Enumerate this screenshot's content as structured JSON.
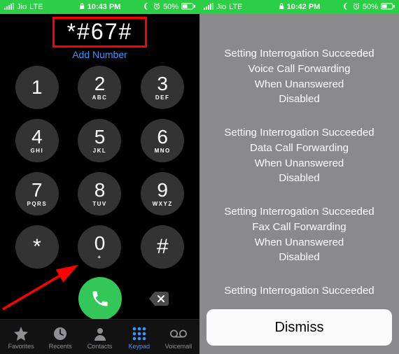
{
  "status_left": {
    "bars_icon": "signal-bars",
    "carrier": "Jio",
    "network": "LTE",
    "time": "10:43 PM",
    "moon_icon": "dnd-moon",
    "alarm_icon": "alarm",
    "battery_text": "50%",
    "battery_icon": "battery-half"
  },
  "status_right": {
    "bars_icon": "signal-bars",
    "carrier": "Jio",
    "network": "LTE",
    "time": "10:42 PM",
    "moon_icon": "dnd-moon",
    "alarm_icon": "alarm",
    "battery_text": "50%",
    "battery_icon": "battery-half"
  },
  "dialer": {
    "number": "*#67#",
    "add_number": "Add Number",
    "keys": [
      {
        "d": "1",
        "l": ""
      },
      {
        "d": "2",
        "l": "ABC"
      },
      {
        "d": "3",
        "l": "DEF"
      },
      {
        "d": "4",
        "l": "GHI"
      },
      {
        "d": "5",
        "l": "JKL"
      },
      {
        "d": "6",
        "l": "MNO"
      },
      {
        "d": "7",
        "l": "PQRS"
      },
      {
        "d": "8",
        "l": "TUV"
      },
      {
        "d": "9",
        "l": "WXYZ"
      },
      {
        "d": "*",
        "l": ""
      },
      {
        "d": "0",
        "l": "+"
      },
      {
        "d": "#",
        "l": ""
      }
    ]
  },
  "tabs": {
    "favorites": "Favorites",
    "recents": "Recents",
    "contacts": "Contacts",
    "keypad": "Keypad",
    "voicemail": "Voicemail"
  },
  "result": {
    "groups": [
      [
        "Setting Interrogation Succeeded",
        "Voice Call Forwarding",
        "When Unanswered",
        "Disabled"
      ],
      [
        "Setting Interrogation Succeeded",
        "Data Call Forwarding",
        "When Unanswered",
        "Disabled"
      ],
      [
        "Setting Interrogation Succeeded",
        "Fax Call Forwarding",
        "When Unanswered",
        "Disabled"
      ]
    ],
    "cutoff": "Setting Interrogation Succeeded",
    "dismiss": "Dismiss"
  }
}
